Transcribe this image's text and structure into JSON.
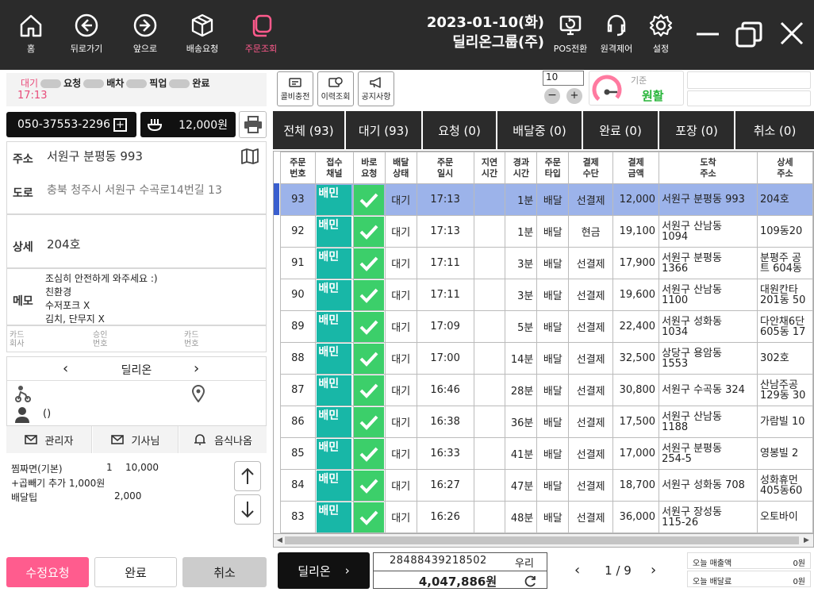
{
  "nav": [
    {
      "label": "홈",
      "icon": "home-icon"
    },
    {
      "label": "뒤로가기",
      "icon": "back-icon"
    },
    {
      "label": "앞으로",
      "icon": "forward-icon"
    },
    {
      "label": "배송요청",
      "icon": "box-icon"
    },
    {
      "label": "주문조회",
      "icon": "copy-icon"
    }
  ],
  "header": {
    "date": "2023-01-10(화)",
    "company": "딜리온그룹(주)"
  },
  "toprightnav": [
    {
      "label": "POS전환",
      "icon": "pos-icon"
    },
    {
      "label": "원격제어",
      "icon": "headset-icon"
    },
    {
      "label": "설정",
      "icon": "gear-icon"
    }
  ],
  "status": {
    "wait": "대기",
    "request": "요청",
    "dispatch": "배차",
    "pickup": "픽업",
    "done": "완료",
    "time": "17:13"
  },
  "order": {
    "phone": "050-37553-2296",
    "amount": "12,000원",
    "address_label": "주소",
    "address": "서원구 분평동 993",
    "road_label": "도로",
    "road": "충북 청주시 서원구 수곡로14번길 13",
    "detail_label": "상세",
    "detail": "204호",
    "memo_label": "메모",
    "memo": [
      "조심히 안전하게 와주세요 :)",
      "친환경",
      "수저포크 X",
      "김치, 단무지 X"
    ],
    "card_company": "카드\n회사",
    "approval": "승인\n번호",
    "card_no": "카드\n번호",
    "agency": "딜리온",
    "customer_phone": "()"
  },
  "contact": {
    "admin": "관리자",
    "rider": "기사님",
    "food": "음식나옴"
  },
  "menu": [
    {
      "name": "찜짜면(기본)",
      "qty": "1",
      "price": "10,000"
    },
    {
      "name": "+곱빼기 추가 1,000원",
      "qty": "",
      "price": ""
    },
    {
      "name": "배달팁",
      "qty": "",
      "price": "2,000"
    }
  ],
  "buttons": {
    "edit": "수정요청",
    "complete": "완료",
    "cancel": "취소"
  },
  "tools": [
    {
      "label": "콜비충전",
      "icon": "charge-icon"
    },
    {
      "label": "이력조회",
      "icon": "history-icon"
    },
    {
      "label": "공지사항",
      "icon": "megaphone-icon"
    }
  ],
  "gauge": {
    "input": "10",
    "label": "기준",
    "status": "원활"
  },
  "tabs": [
    {
      "label": "전체 (93)"
    },
    {
      "label": "대기 (93)"
    },
    {
      "label": "요청 (0)"
    },
    {
      "label": "배달중 (0)"
    },
    {
      "label": "완료 (0)"
    },
    {
      "label": "포장 (0)"
    },
    {
      "label": "취소 (0)"
    }
  ],
  "table": {
    "headers": [
      "주문\n번호",
      "접수\n채널",
      "바로\n요청",
      "배달\n상태",
      "주문\n일시",
      "지연\n시간",
      "경과\n시간",
      "주문\n타입",
      "결제\n수단",
      "결제\n금액",
      "도착\n주소",
      "상세\n주소"
    ],
    "rows": [
      [
        "93",
        "대기",
        "17:13",
        "",
        "1분",
        "배달",
        "선결제",
        "12,000",
        "서원구 분평동 993",
        "204호"
      ],
      [
        "92",
        "대기",
        "17:13",
        "",
        "1분",
        "배달",
        "현금",
        "19,100",
        "서원구 산남동\n1094",
        "109동20"
      ],
      [
        "91",
        "대기",
        "17:11",
        "",
        "3분",
        "배달",
        "선결제",
        "17,900",
        "서원구 분평동\n1366",
        "분평주 공\n트 604동"
      ],
      [
        "90",
        "대기",
        "17:11",
        "",
        "3분",
        "배달",
        "선결제",
        "19,600",
        "서원구 산남동\n1100",
        "대원칸타\n201동 50"
      ],
      [
        "89",
        "대기",
        "17:09",
        "",
        "5분",
        "배달",
        "선결제",
        "22,400",
        "서원구 성화동\n1034",
        "다안채6단\n605동 17"
      ],
      [
        "88",
        "대기",
        "17:00",
        "",
        "14분",
        "배달",
        "선결제",
        "32,500",
        "상당구 용암동\n1553",
        "302호"
      ],
      [
        "87",
        "대기",
        "16:46",
        "",
        "28분",
        "배달",
        "선결제",
        "30,800",
        "서원구 수곡동 324",
        "산남주공\n129동 30"
      ],
      [
        "86",
        "대기",
        "16:38",
        "",
        "36분",
        "배달",
        "선결제",
        "17,500",
        "서원구 산남동\n1188",
        "가람빌 10"
      ],
      [
        "85",
        "대기",
        "16:33",
        "",
        "41분",
        "배달",
        "선결제",
        "17,000",
        "서원구 분평동\n254-5",
        "영봉빌 2"
      ],
      [
        "84",
        "대기",
        "16:27",
        "",
        "47분",
        "배달",
        "선결제",
        "18,700",
        "서원구 성화동 708",
        "성화휴먼\n405동60"
      ],
      [
        "83",
        "대기",
        "16:26",
        "",
        "48분",
        "배달",
        "선결제",
        "36,000",
        "서원구 장성동\n115-26",
        "오토바이"
      ]
    ],
    "channel_logo": "배민"
  },
  "footer": {
    "agency": "딜리온",
    "account": "28488439218502",
    "bank": "우리",
    "balance": "4,047,886원",
    "page": "1 / 9",
    "sales_label": "오늘 매출액",
    "sales": "0원",
    "fee_label": "오늘 배달료",
    "fee": "0원"
  }
}
